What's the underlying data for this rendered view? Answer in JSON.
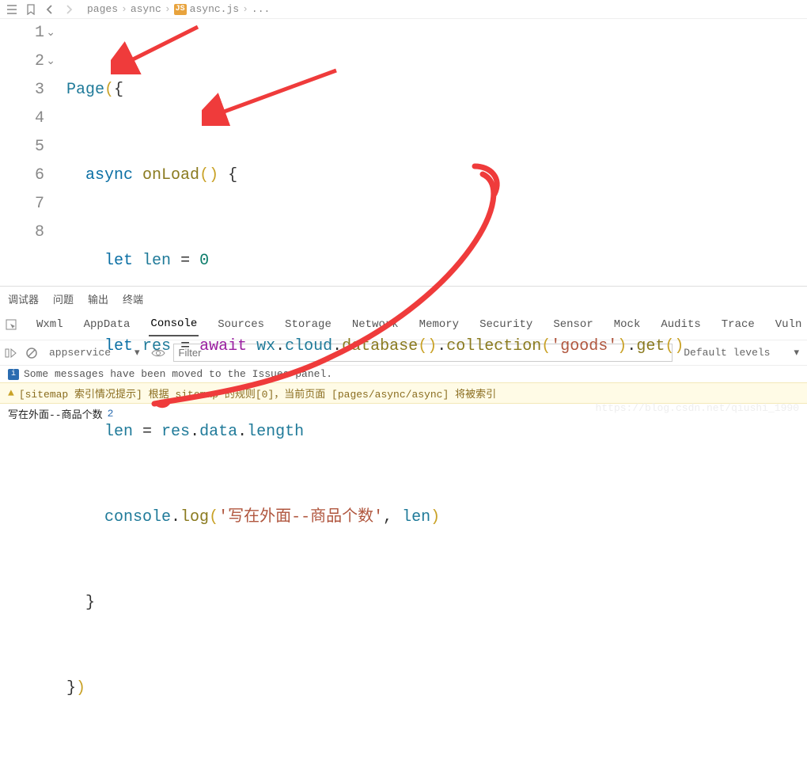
{
  "breadcrumb": {
    "p0": "pages",
    "p1": "async",
    "file": "async.js",
    "more": "..."
  },
  "code": {
    "page": "Page",
    "async": "async",
    "onLoad": "onLoad",
    "let": "let",
    "len": "len",
    "zero": "0",
    "res": "res",
    "await": "await",
    "wx": "wx",
    "cloud": "cloud",
    "database": "database",
    "collection": "collection",
    "goods": "'goods'",
    "get": "get",
    "data": "data",
    "length": "length",
    "console": "console",
    "log": "log",
    "logStr": "'写在外面--商品个数'"
  },
  "lines": {
    "l1": "1",
    "l2": "2",
    "l3": "3",
    "l4": "4",
    "l5": "5",
    "l6": "6",
    "l7": "7",
    "l8": "8"
  },
  "bottom": {
    "tabs": {
      "debugger": "调试器",
      "problems": "问题",
      "output": "输出",
      "terminal": "终端"
    },
    "devtabs": {
      "wxml": "Wxml",
      "appdata": "AppData",
      "console": "Console",
      "sources": "Sources",
      "storage": "Storage",
      "network": "Network",
      "memory": "Memory",
      "security": "Security",
      "sensor": "Sensor",
      "mock": "Mock",
      "audits": "Audits",
      "trace": "Trace",
      "vuln": "Vuln"
    },
    "toolbar": {
      "context": "appservice",
      "filter_placeholder": "Filter",
      "levels": "Default levels"
    },
    "logs": {
      "moved": "Some messages have been moved to the Issues panel.",
      "sitemap": "[sitemap 索引情况提示] 根据 sitemap 的规则[0]，当前页面 [pages/async/async] 将被索引",
      "out_label": "写在外面--商品个数",
      "out_value": "2"
    }
  },
  "watermark": "https://blog.csdn.net/qiushi_1990"
}
